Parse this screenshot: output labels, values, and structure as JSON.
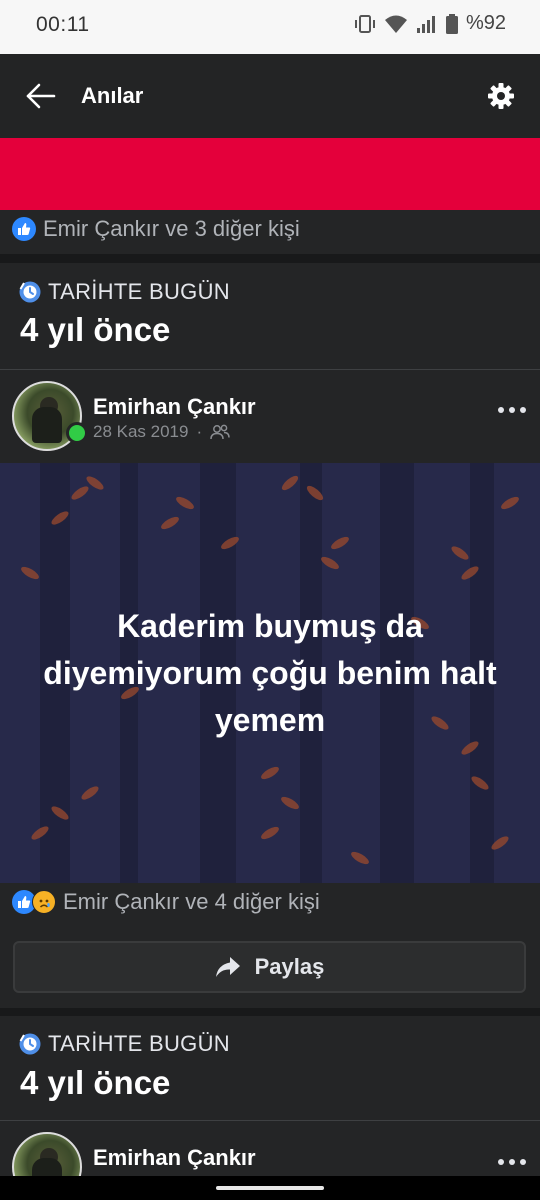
{
  "status_bar": {
    "time": "00:11",
    "battery": "%92"
  },
  "app_bar": {
    "title": "Anılar"
  },
  "top_card": {
    "reactions_text": "Emir Çankır ve 3 diğer kişi"
  },
  "memory_sections": [
    {
      "label": "TARİHTE BUGÜN",
      "years_ago": "4 yıl önce"
    },
    {
      "label": "TARİHTE BUGÜN",
      "years_ago": "4 yıl önce"
    }
  ],
  "post": {
    "author": "Emirhan Çankır",
    "date": "28 Kas 2019",
    "audience_icon": "friends-icon",
    "text": "Kaderim buymuş da diyemiyorum çoğu benim halt yemem",
    "reactions_text": "Emir Çankır ve 4 diğer kişi",
    "share_label": "Paylaş"
  },
  "second_post": {
    "author": "Emirhan Çankır"
  },
  "colors": {
    "background": "#18191a",
    "card": "#242526",
    "banner": "#e4003b",
    "post_bg": "#27294a",
    "like": "#2d88ff",
    "online": "#31cc46"
  }
}
